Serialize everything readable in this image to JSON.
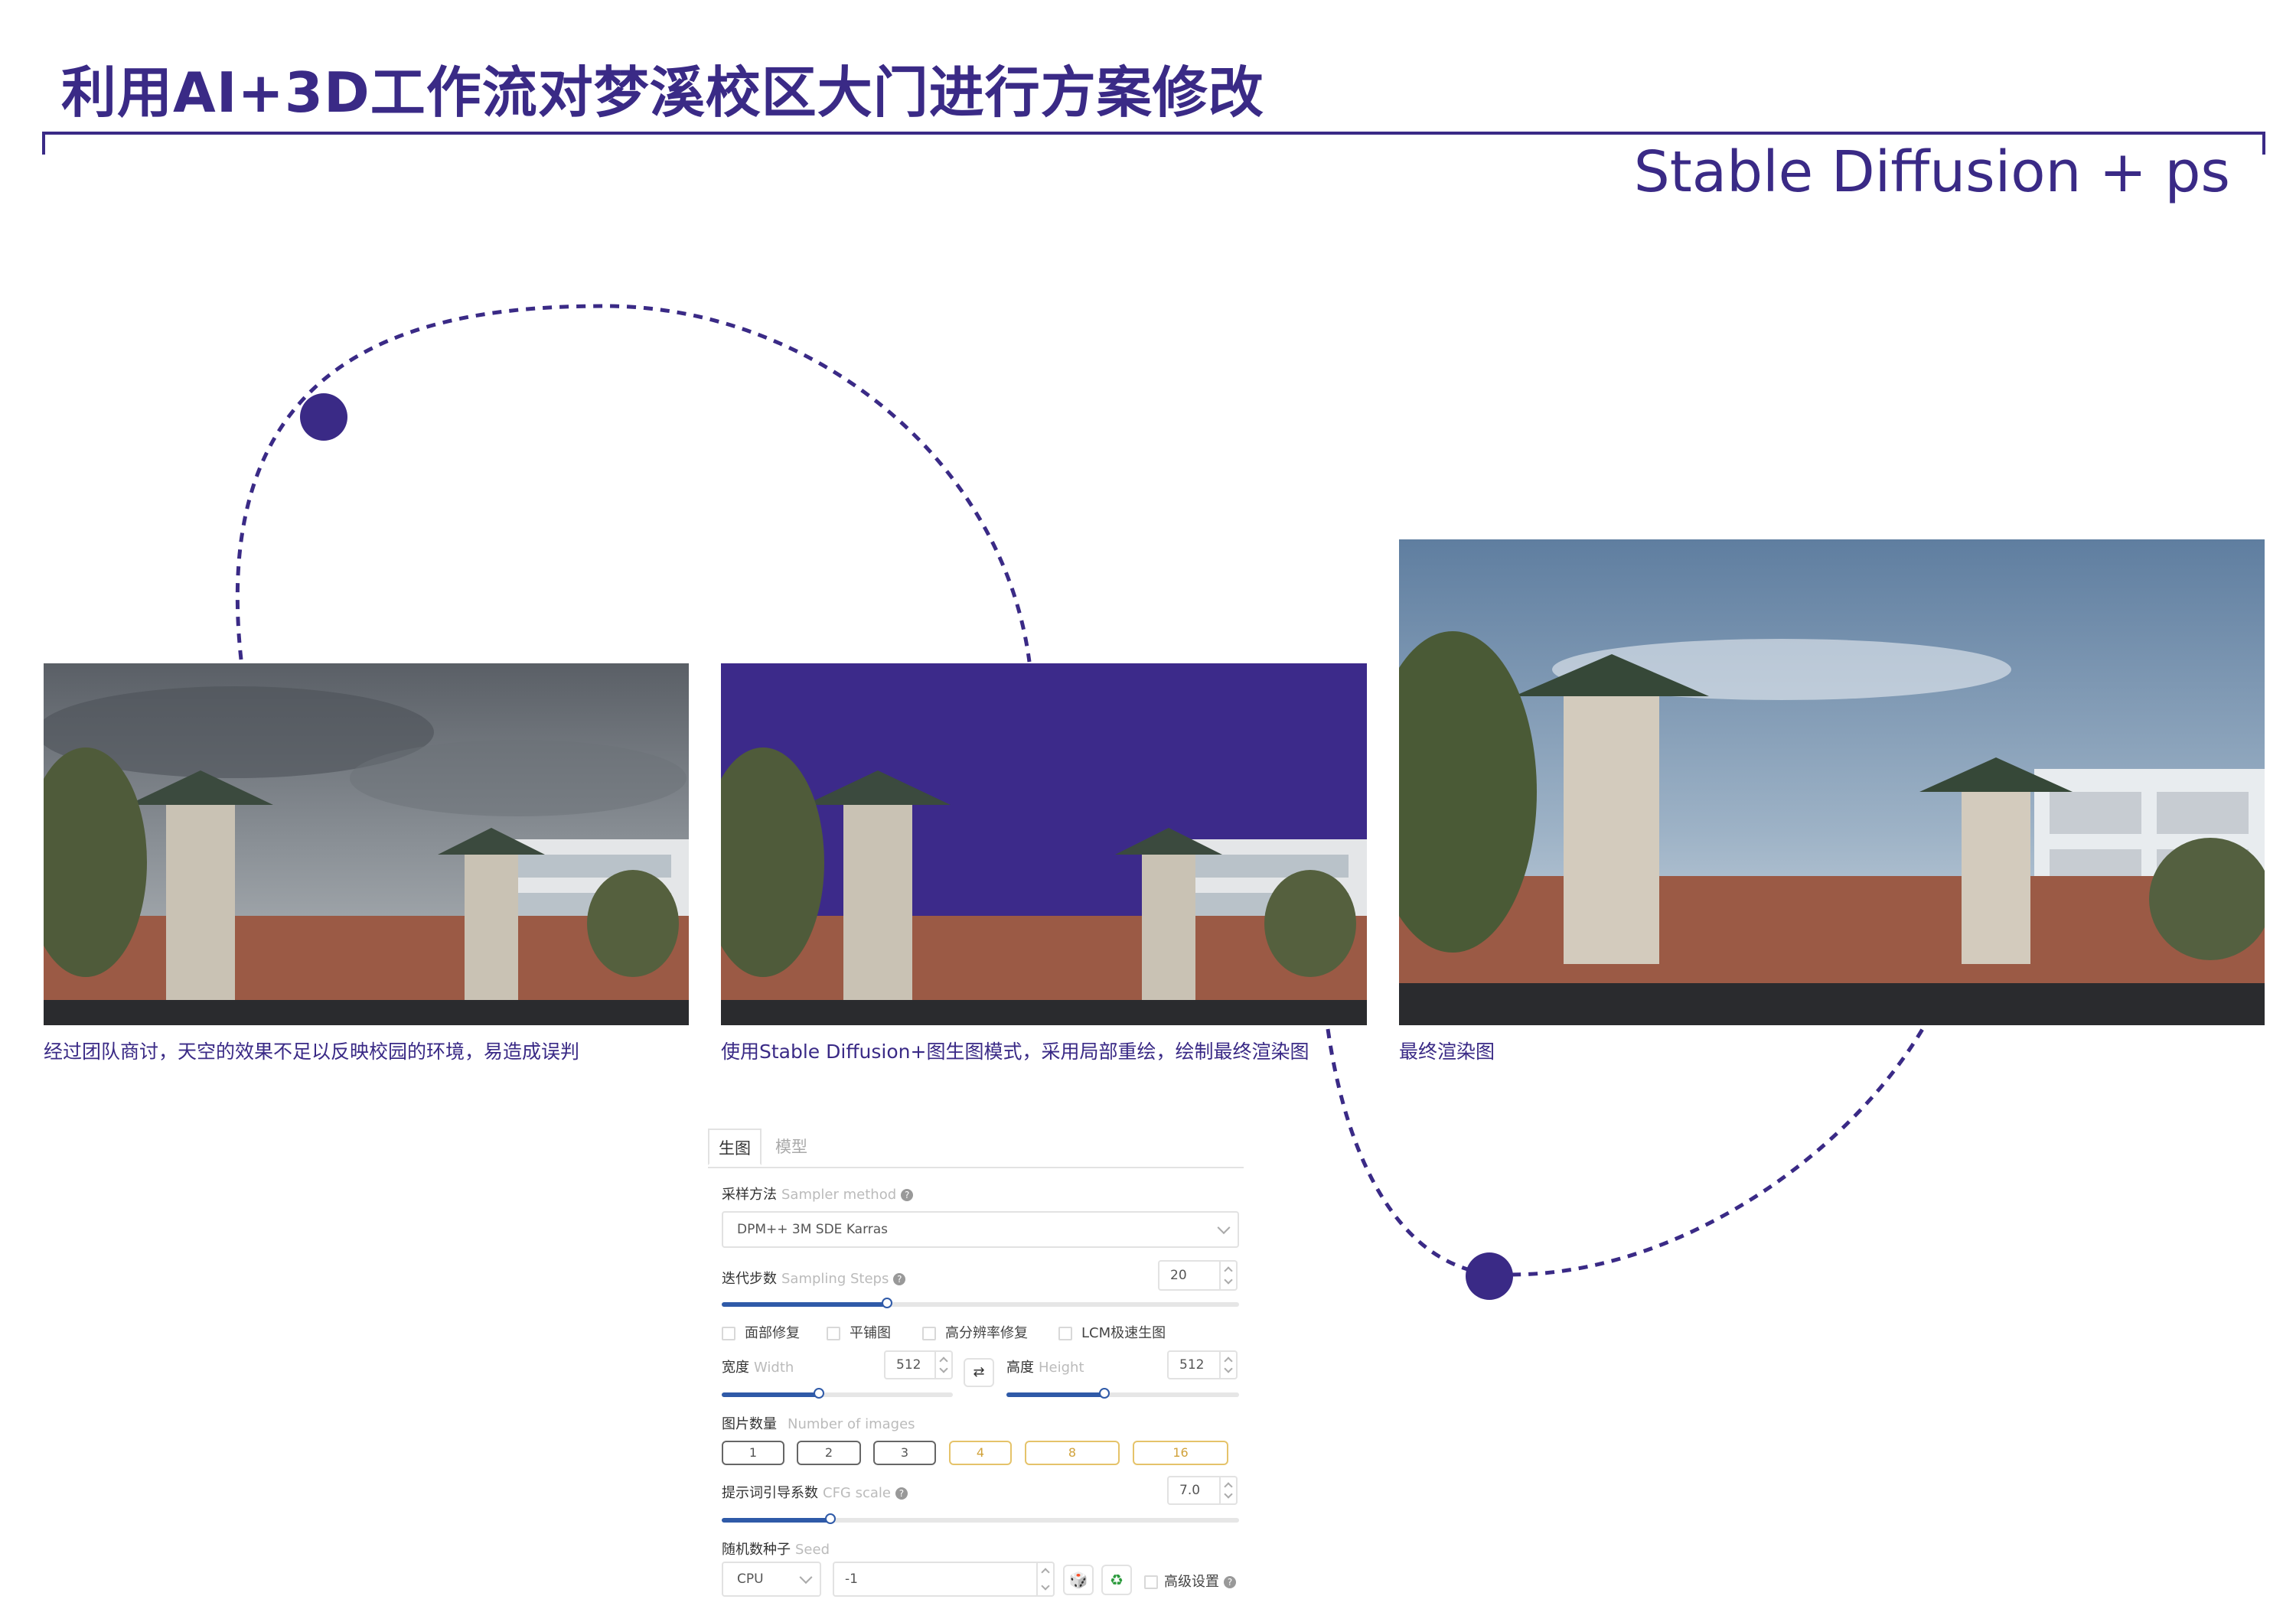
{
  "header": {
    "title": "利用AI+3D工作流对梦溪校区大门进行方案修改",
    "subtitle": "Stable Diffusion + ps"
  },
  "colors": {
    "accent": "#3a2a86",
    "sky_fill": "#3c2a8a",
    "slider_fill": "#2f5aa8",
    "gold": "#d1a23a"
  },
  "images": [
    {
      "caption": "经过团队商讨，天空的效果不足以反映校园的环境，易造成误判"
    },
    {
      "caption": "使用Stable Diffusion+图生图模式，采用局部重绘，绘制最终渲染图"
    },
    {
      "caption": "最终渲染图"
    }
  ],
  "sd_panel": {
    "tabs": [
      {
        "label": "生图",
        "active": true
      },
      {
        "label": "模型",
        "active": false
      }
    ],
    "sampler": {
      "label": "采样方法",
      "label_en": "Sampler method",
      "value": "DPM++ 3M SDE Karras"
    },
    "steps": {
      "label": "迭代步数",
      "label_en": "Sampling Steps",
      "value": "20",
      "fraction": 0.32
    },
    "checkboxes": [
      "面部修复",
      "平铺图",
      "高分辨率修复",
      "LCM极速生图"
    ],
    "width": {
      "label": "宽度",
      "label_en": "Width",
      "value": "512",
      "fraction": 0.42
    },
    "height": {
      "label": "高度",
      "label_en": "Height",
      "value": "512",
      "fraction": 0.42
    },
    "swap_icon": "⇄",
    "num_images": {
      "label": "图片数量",
      "label_en": "Number of images",
      "options": [
        "1",
        "2",
        "3",
        "4",
        "8",
        "16"
      ]
    },
    "cfg": {
      "label": "提示词引导系数",
      "label_en": "CFG scale",
      "value": "7.0",
      "fraction": 0.21
    },
    "seed": {
      "label": "随机数种子",
      "label_en": "Seed",
      "device": "CPU",
      "value": "-1",
      "dice_icon": "🎲",
      "recycle_icon": "♻",
      "advanced_label": "高级设置"
    },
    "help_glyph": "?"
  }
}
